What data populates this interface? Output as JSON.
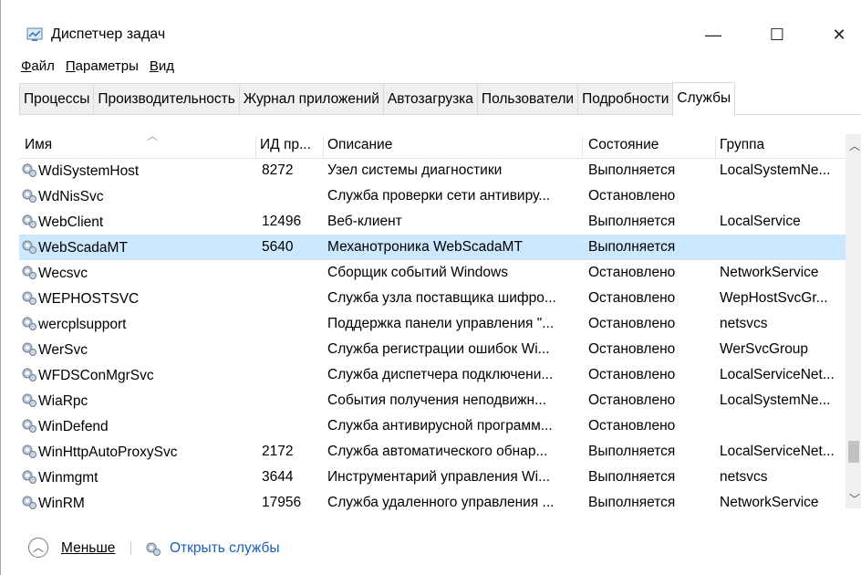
{
  "window": {
    "title": "Диспетчер задач",
    "minimize": "—",
    "maximize": "☐",
    "close": "✕"
  },
  "menu": [
    {
      "key": "Ф",
      "rest": "айл"
    },
    {
      "key": "П",
      "rest": "араметры"
    },
    {
      "key": "В",
      "rest": "ид"
    }
  ],
  "tabs": [
    "Процессы",
    "Производительность",
    "Журнал приложений",
    "Автозагрузка",
    "Пользователи",
    "Подробности",
    "Службы"
  ],
  "columns": {
    "name": "Имя",
    "pid": "ИД пр...",
    "desc": "Описание",
    "state": "Состояние",
    "group": "Группа"
  },
  "services": [
    {
      "name": "WdiSystemHost",
      "pid": "8272",
      "desc": "Узел системы диагностики",
      "state": "Выполняется",
      "group": "LocalSystemNe..."
    },
    {
      "name": "WdNisSvc",
      "pid": "",
      "desc": "Служба проверки сети антивиру...",
      "state": "Остановлено",
      "group": ""
    },
    {
      "name": "WebClient",
      "pid": "12496",
      "desc": "Веб-клиент",
      "state": "Выполняется",
      "group": "LocalService"
    },
    {
      "name": "WebScadaMT",
      "pid": "5640",
      "desc": "Механотроника WebScadaMT",
      "state": "Выполняется",
      "group": ""
    },
    {
      "name": "Wecsvc",
      "pid": "",
      "desc": "Сборщик событий Windows",
      "state": "Остановлено",
      "group": "NetworkService"
    },
    {
      "name": "WEPHOSTSVC",
      "pid": "",
      "desc": "Служба узла поставщика шифро...",
      "state": "Остановлено",
      "group": "WepHostSvcGr..."
    },
    {
      "name": "wercplsupport",
      "pid": "",
      "desc": "Поддержка панели управления \"...",
      "state": "Остановлено",
      "group": "netsvcs"
    },
    {
      "name": "WerSvc",
      "pid": "",
      "desc": "Служба регистрации ошибок Wi...",
      "state": "Остановлено",
      "group": "WerSvcGroup"
    },
    {
      "name": "WFDSConMgrSvc",
      "pid": "",
      "desc": "Служба диспетчера подключени...",
      "state": "Остановлено",
      "group": "LocalServiceNet..."
    },
    {
      "name": "WiaRpc",
      "pid": "",
      "desc": "События получения неподвижн...",
      "state": "Остановлено",
      "group": "LocalSystemNe..."
    },
    {
      "name": "WinDefend",
      "pid": "",
      "desc": "Служба антивирусной программ...",
      "state": "Остановлено",
      "group": ""
    },
    {
      "name": "WinHttpAutoProxySvc",
      "pid": "2172",
      "desc": "Служба автоматического обнар...",
      "state": "Выполняется",
      "group": "LocalServiceNet..."
    },
    {
      "name": "Winmgmt",
      "pid": "3644",
      "desc": "Инструментарий управления Wi...",
      "state": "Выполняется",
      "group": "netsvcs"
    },
    {
      "name": "WinRM",
      "pid": "17956",
      "desc": "Служба удаленного управления ...",
      "state": "Выполняется",
      "group": "NetworkService"
    }
  ],
  "selected_row": "WebScadaMT",
  "footer": {
    "less_label": "Меньше",
    "open_services_label": "Открыть службы"
  },
  "colors": {
    "selection": "#cce8ff",
    "link": "#1a5fb4"
  },
  "icons": {
    "service": "gear-icon",
    "app": "task-manager-icon"
  }
}
